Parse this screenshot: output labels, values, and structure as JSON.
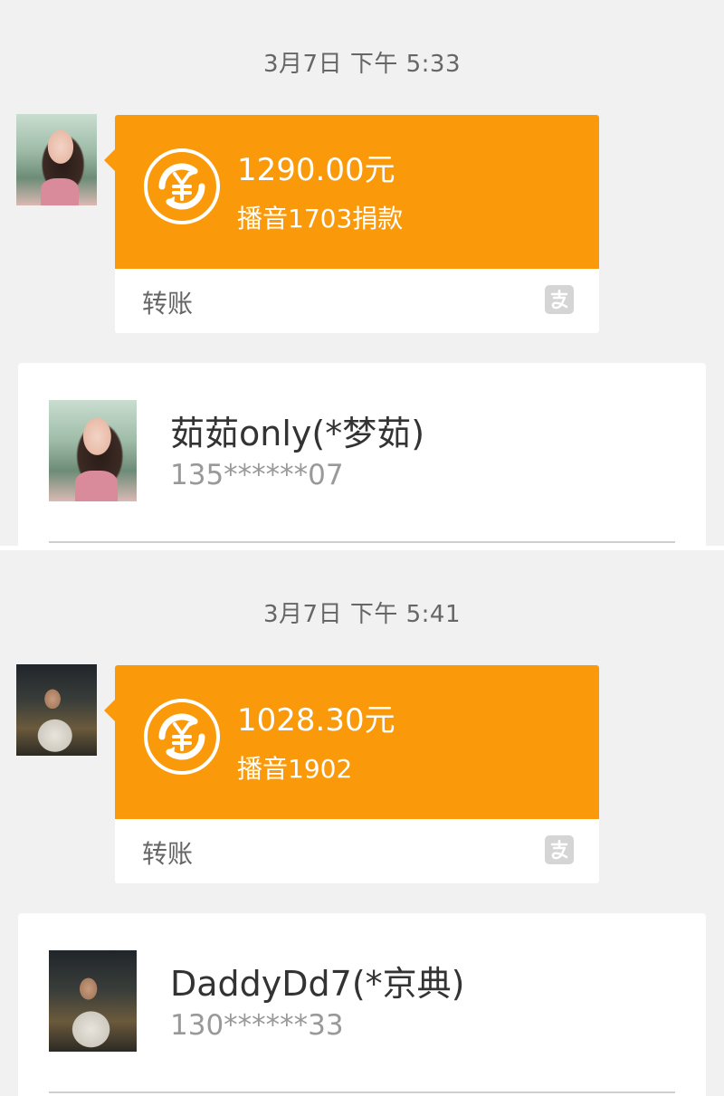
{
  "messages": [
    {
      "time": "3月7日 下午 5:33",
      "amount": "1290.00元",
      "memo": "播音1703捐款",
      "kind": "转账",
      "contact": {
        "name": "茹茹only(*梦茹)",
        "phone": "135******07"
      }
    },
    {
      "time": "3月7日 下午 5:41",
      "amount": "1028.30元",
      "memo": "播音1902",
      "kind": "转账",
      "contact": {
        "name": "DaddyDd7(*京典)",
        "phone": "130******33"
      }
    }
  ],
  "icons": {
    "transfer": "yuan-transfer-icon",
    "brand": "alipay-icon"
  },
  "colors": {
    "accent": "#fa9a0b",
    "background": "#f1f1f1"
  }
}
